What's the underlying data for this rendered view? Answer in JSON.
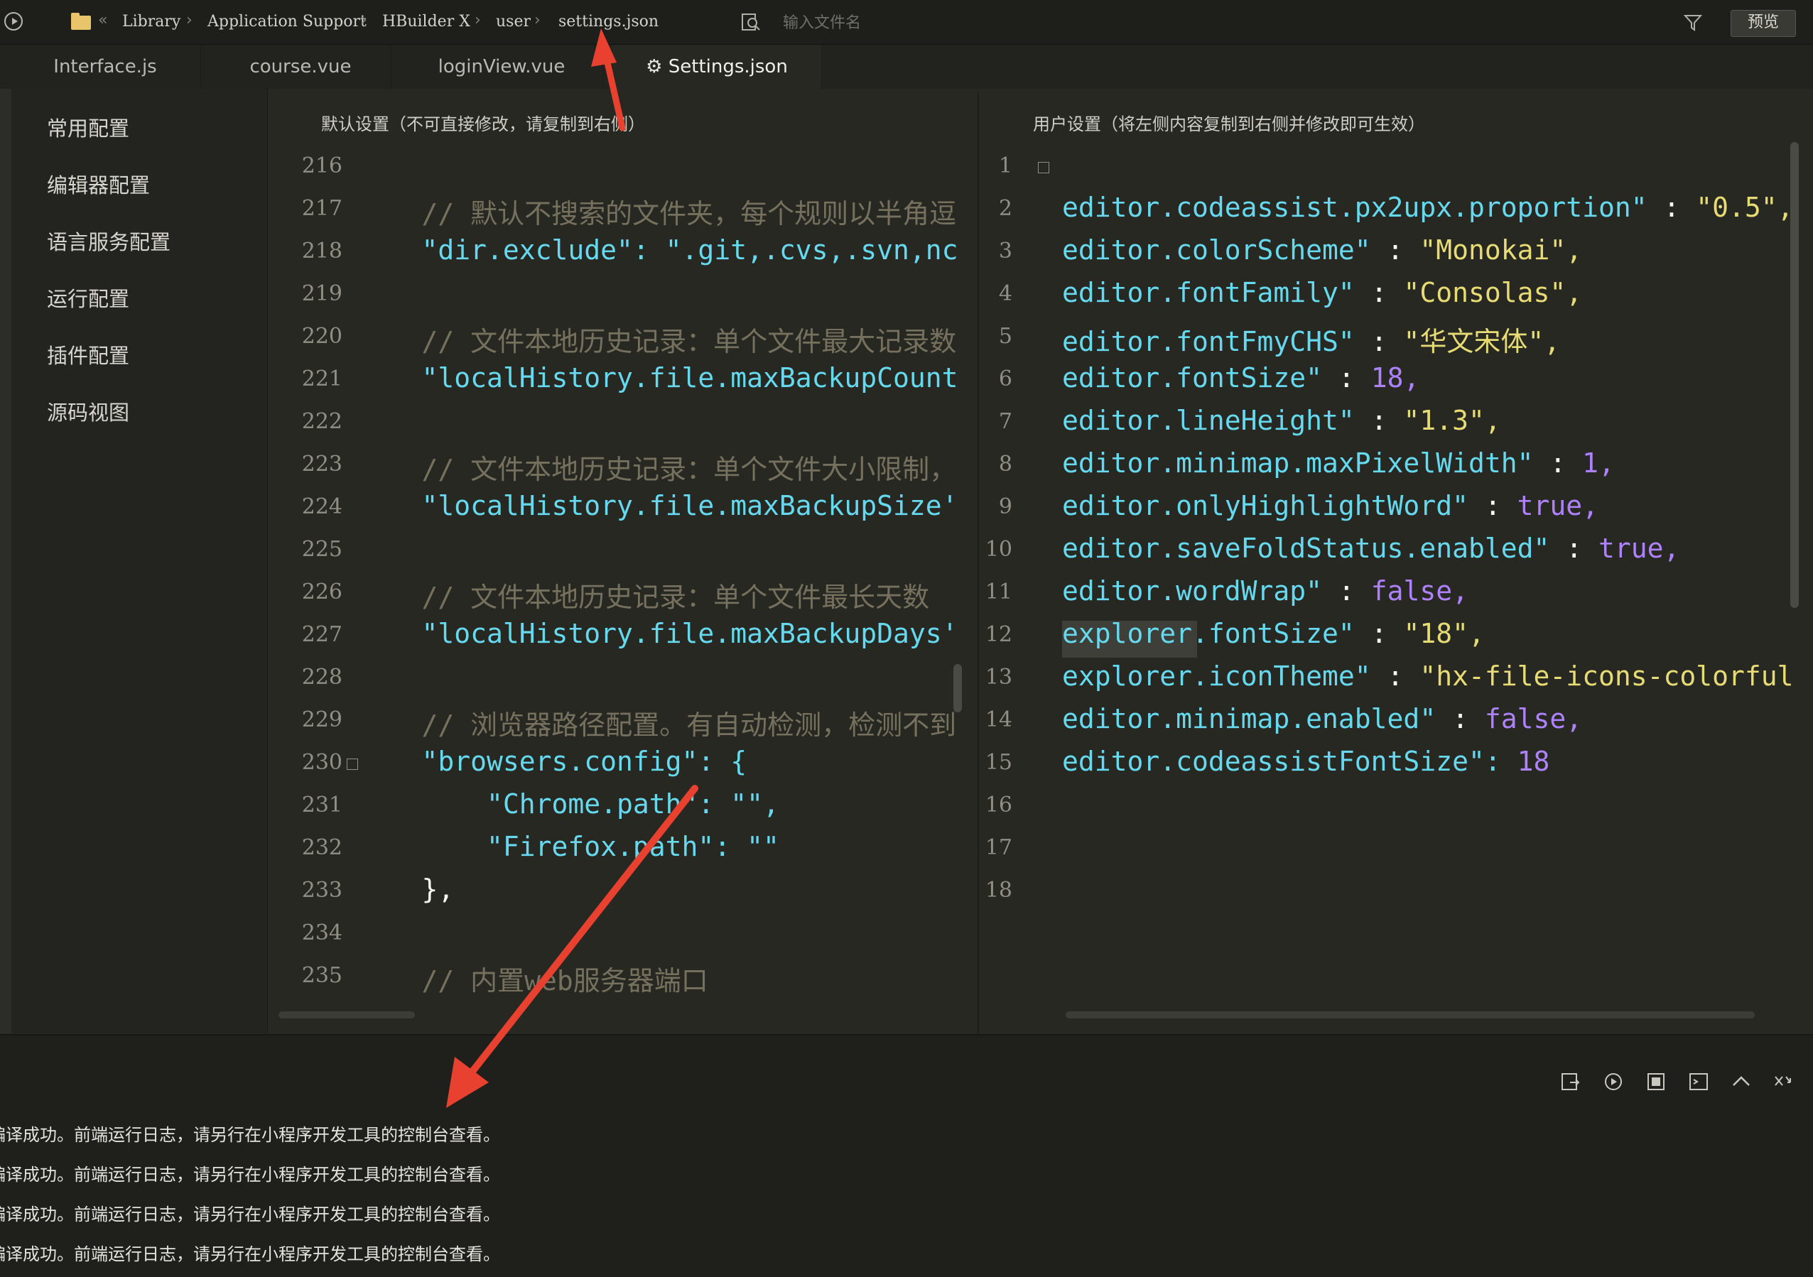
{
  "topbar": {
    "breadcrumb": [
      "Library",
      "Application Support",
      "HBuilder X",
      "user",
      "settings.json"
    ],
    "back_symbol": "«",
    "separator": "›",
    "search_placeholder": "输入文件名",
    "preview_label": "预览"
  },
  "tabs": [
    {
      "label": "Interface.js"
    },
    {
      "label": "course.vue"
    },
    {
      "label": "loginView.vue"
    },
    {
      "label": "Settings.json",
      "active": true
    }
  ],
  "nav": {
    "items": [
      "常用配置",
      "编辑器配置",
      "语言服务配置",
      "运行配置",
      "插件配置",
      "源码视图"
    ]
  },
  "left_pane": {
    "title": "默认设置（不可直接修改，请复制到右侧）",
    "lines": [
      {
        "n": "216",
        "t": ""
      },
      {
        "n": "217",
        "t": "    // 默认不搜索的文件夹，每个规则以半角逗"
      },
      {
        "n": "218",
        "t": "    \"dir.exclude\": \".git,.cvs,.svn,nc"
      },
      {
        "n": "219",
        "t": ""
      },
      {
        "n": "220",
        "t": "    // 文件本地历史记录：单个文件最大记录数"
      },
      {
        "n": "221",
        "t": "    \"localHistory.file.maxBackupCount"
      },
      {
        "n": "222",
        "t": ""
      },
      {
        "n": "223",
        "t": "    // 文件本地历史记录：单个文件大小限制，"
      },
      {
        "n": "224",
        "t": "    \"localHistory.file.maxBackupSize'"
      },
      {
        "n": "225",
        "t": ""
      },
      {
        "n": "226",
        "t": "    // 文件本地历史记录：单个文件最长天数"
      },
      {
        "n": "227",
        "t": "    \"localHistory.file.maxBackupDays'"
      },
      {
        "n": "228",
        "t": ""
      },
      {
        "n": "229",
        "t": "    // 浏览器路径配置。有自动检测，检测不到"
      },
      {
        "n": "230",
        "t": "    \"browsers.config\": {"
      },
      {
        "n": "231",
        "t": "        \"Chrome.path\": \"\","
      },
      {
        "n": "232",
        "t": "        \"Firefox.path\": \"\""
      },
      {
        "n": "233",
        "t": "    },"
      },
      {
        "n": "234",
        "t": ""
      },
      {
        "n": "235",
        "t": "    // 内置web服务器端口"
      }
    ]
  },
  "right_pane": {
    "title": "用户设置（将左侧内容复制到右侧并修改即可生效）",
    "lines": [
      {
        "n": "1",
        "k": "",
        "v": ""
      },
      {
        "n": "2",
        "k": "editor.codeassist.px2upx.proportion\"",
        "v": "\"0.5\","
      },
      {
        "n": "3",
        "k": "editor.colorScheme\"",
        "v": "\"Monokai\","
      },
      {
        "n": "4",
        "k": "editor.fontFamily\"",
        "v": "\"Consolas\","
      },
      {
        "n": "5",
        "k": "editor.fontFmyCHS\"",
        "v": "\"华文宋体\","
      },
      {
        "n": "6",
        "k": "editor.fontSize\"",
        "v": "18,"
      },
      {
        "n": "7",
        "k": "editor.lineHeight\"",
        "v": "\"1.3\","
      },
      {
        "n": "8",
        "k": "editor.minimap.maxPixelWidth\"",
        "v": "1,"
      },
      {
        "n": "9",
        "k": "editor.onlyHighlightWord\"",
        "v": "true,"
      },
      {
        "n": "10",
        "k": "editor.saveFoldStatus.enabled\"",
        "v": "true,"
      },
      {
        "n": "11",
        "k": "editor.wordWrap\"",
        "v": "false,"
      },
      {
        "n": "12",
        "k": "explorer.fontSize\"",
        "v": "\"18\","
      },
      {
        "n": "13",
        "k": "explorer.iconTheme\"",
        "v": "\"hx-file-icons-colorful"
      },
      {
        "n": "14",
        "k": "editor.minimap.enabled\"",
        "v": "false,"
      },
      {
        "n": "15",
        "k": "editor.codeassistFontSize\":",
        "v": "18"
      },
      {
        "n": "16",
        "k": "",
        "v": ""
      },
      {
        "n": "17",
        "k": "",
        "v": ""
      },
      {
        "n": "18",
        "k": "",
        "v": ""
      }
    ]
  },
  "console": {
    "lines": [
      "编译成功。前端运行日志，请另行在小程序开发工具的控制台查看。",
      "编译成功。前端运行日志，请另行在小程序开发工具的控制台查看。",
      "编译成功。前端运行日志，请另行在小程序开发工具的控制台查看。",
      "编译成功。前端运行日志，请另行在小程序开发工具的控制台查看。"
    ],
    "icons": [
      "clear-icon",
      "restart-icon",
      "stop-icon",
      "terminal-icon",
      "collapse-icon",
      "close-panel-icon"
    ]
  },
  "colors": {
    "background": "#272822",
    "string": "#e6db74",
    "key": "#66d9ef",
    "comment": "#75715e",
    "number": "#ae81ff",
    "annotation_arrow": "#e8412f"
  }
}
